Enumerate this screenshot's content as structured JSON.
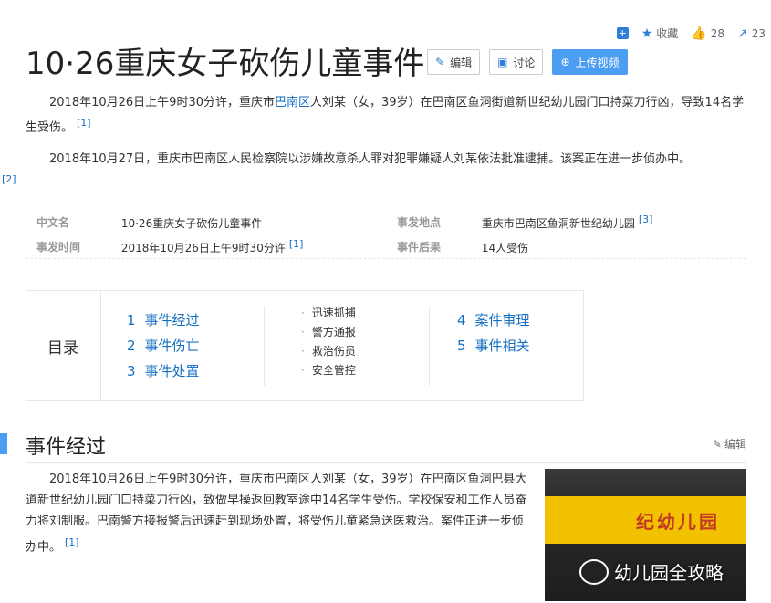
{
  "top_actions": {
    "favorite_label": "收藏",
    "like_count": "28",
    "share_count": "23"
  },
  "page_title": "10·26重庆女子砍伤儿童事件",
  "title_buttons": {
    "edit": "编辑",
    "discuss": "讨论",
    "upload_video": "上传视频"
  },
  "summary": {
    "p1_a": "2018年10月26日上午9时30分许，重庆市",
    "p1_link": "巴南区",
    "p1_b": "人刘某（女，39岁）在巴南区鱼洞街道新世纪幼儿园门口持菜刀行凶，导致14名学生受伤。",
    "p1_ref": "[1]",
    "p2": "2018年10月27日，重庆市巴南区人民检察院以涉嫌故意杀人罪对犯罪嫌疑人刘某依法批准逮捕。该案正在进一步侦办中。",
    "p2_ref": "[2]"
  },
  "basic_info": {
    "rows": [
      {
        "k1": "中文名",
        "v1": "10·26重庆女子砍伤儿童事件",
        "r1": "",
        "k2": "事发地点",
        "v2": "重庆市巴南区鱼洞新世纪幼儿园",
        "r2": "[3]"
      },
      {
        "k1": "事发时间",
        "v1": "2018年10月26日上午9时30分许",
        "r1": "[1]",
        "k2": "事件后果",
        "v2": "14人受伤",
        "r2": ""
      }
    ]
  },
  "toc": {
    "label": "目录",
    "col1": [
      {
        "num": "1",
        "text": "事件经过"
      },
      {
        "num": "2",
        "text": "事件伤亡"
      },
      {
        "num": "3",
        "text": "事件处置"
      }
    ],
    "subs": [
      "迅速抓捕",
      "警方通报",
      "救治伤员",
      "安全管控"
    ],
    "col3": [
      {
        "num": "4",
        "text": "案件审理"
      },
      {
        "num": "5",
        "text": "事件相关"
      }
    ]
  },
  "section1": {
    "title": "事件经过",
    "edit": "编辑",
    "text": "2018年10月26日上午9时30分许，重庆市巴南区人刘某（女，39岁）在巴南区鱼洞巴县大道新世纪幼儿园门口持菜刀行凶，致做早操返回教室途中14名学生受伤。学校保安和工作人员奋力将刘制服。巴南警方接报警后迅速赶到现场处置，将受伤儿童紧急送医救治。案件正进一步侦办中。",
    "ref": "[1]",
    "image_sign_text": "纪幼儿园",
    "image_watermark": "幼儿园全攻略"
  },
  "colors": {
    "link": "#136ec2",
    "accent": "#4b9ef2",
    "sign_yellow": "#f2c200"
  }
}
